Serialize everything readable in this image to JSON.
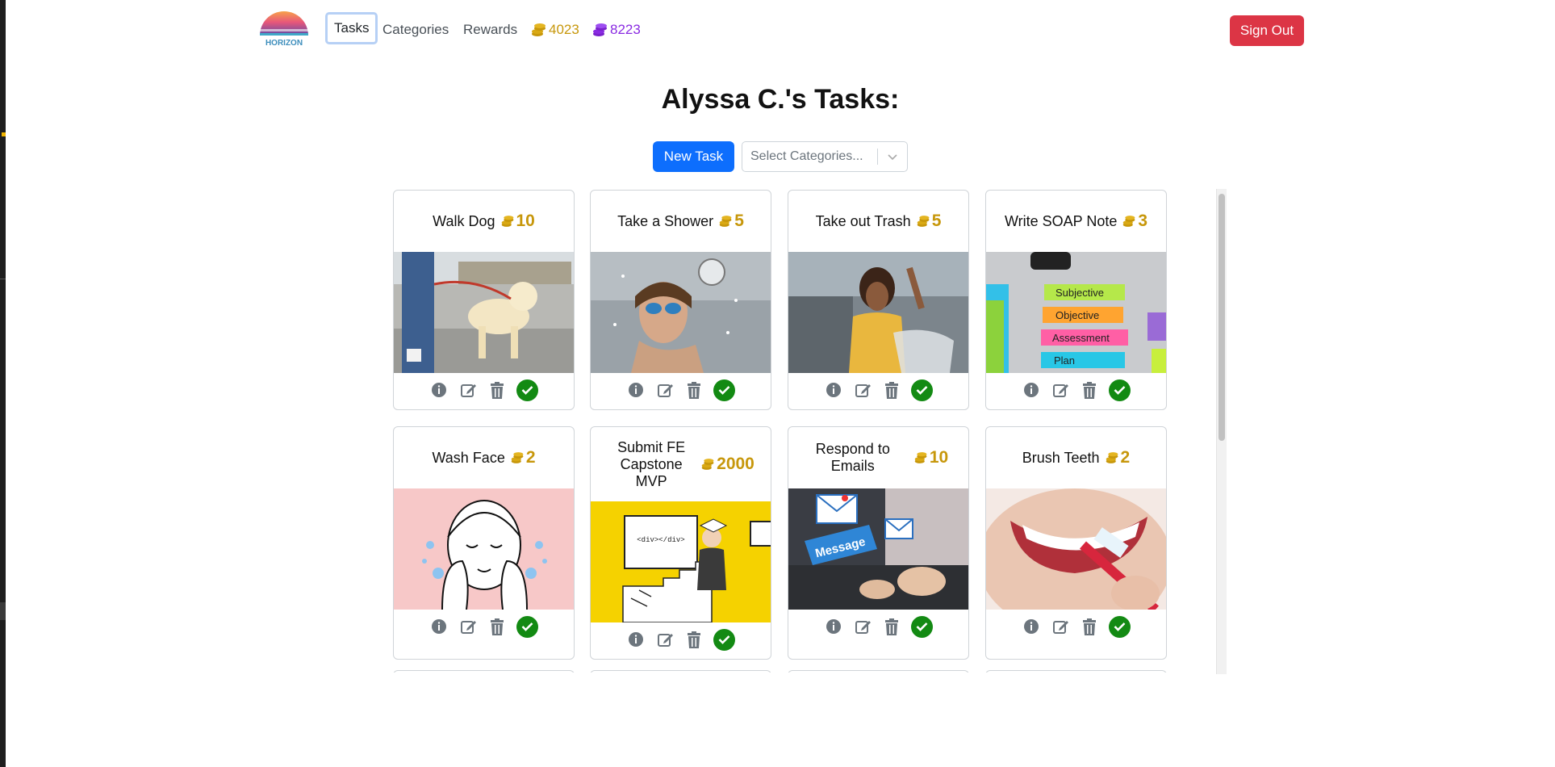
{
  "nav": {
    "logo_text": "HORIZON",
    "links": [
      {
        "label": "Tasks",
        "active": true
      },
      {
        "label": "Categories",
        "active": false
      },
      {
        "label": "Rewards",
        "active": false
      }
    ],
    "gold_coins": "4023",
    "purple_coins": "8223",
    "signout_label": "Sign Out"
  },
  "header": {
    "title": "Alyssa C.'s Tasks:",
    "new_task_label": "New Task",
    "category_placeholder": "Select Categories..."
  },
  "tasks": [
    {
      "title": "Walk Dog",
      "points": "10",
      "image": "dog-walking-photo"
    },
    {
      "title": "Take a Shower",
      "points": "5",
      "image": "shower-photo"
    },
    {
      "title": "Take out Trash",
      "points": "5",
      "image": "trash-photo"
    },
    {
      "title": "Write SOAP Note",
      "points": "3",
      "image": "soap-note-photo",
      "notes": [
        "Subjective",
        "Objective",
        "Assessment",
        "Plan"
      ]
    },
    {
      "title": "Wash Face",
      "points": "2",
      "image": "wash-face-illustration"
    },
    {
      "title": "Submit FE Capstone MVP",
      "points": "2000",
      "image": "capstone-illustration",
      "code_text": "<div></div>"
    },
    {
      "title": "Respond to Emails",
      "points": "10",
      "image": "email-photo",
      "banner_text": "Message"
    },
    {
      "title": "Brush Teeth",
      "points": "2",
      "image": "toothbrush-photo"
    }
  ],
  "colors": {
    "gold": "#c7970b",
    "purple": "#8a2be2",
    "primary": "#0d6efd",
    "danger": "#dc3545",
    "success": "#138a13"
  }
}
